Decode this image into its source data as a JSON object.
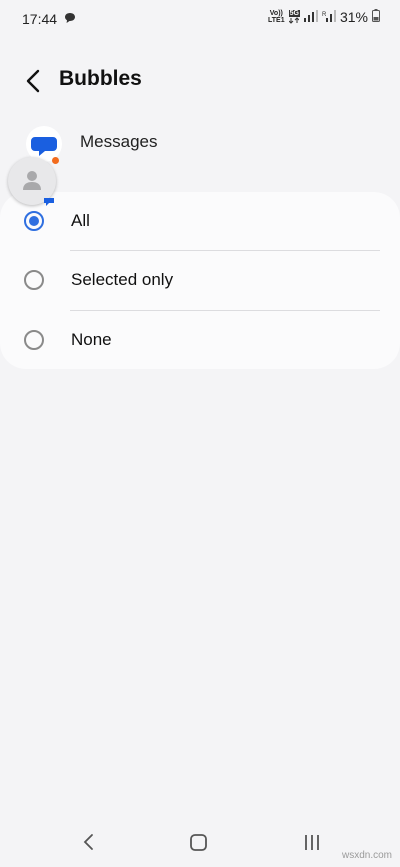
{
  "status_bar": {
    "time": "17:44",
    "lte_top": "Vo))",
    "lte_bottom": "LTE1",
    "net_top": "5G",
    "battery": "31%"
  },
  "header": {
    "title": "Bubbles"
  },
  "app": {
    "name": "Messages"
  },
  "options": [
    {
      "label": "All",
      "selected": true
    },
    {
      "label": "Selected only",
      "selected": false
    },
    {
      "label": "None",
      "selected": false
    }
  ],
  "watermark": "wsxdn.com",
  "colors": {
    "accent": "#2f6fe0",
    "background": "#f4f4f6",
    "card": "#fbfbfc",
    "notification_dot": "#f26b1d"
  }
}
